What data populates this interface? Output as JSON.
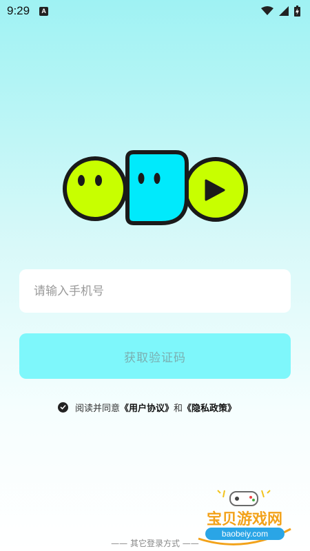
{
  "status_bar": {
    "time": "9:29",
    "notification_letter": "A",
    "icons": [
      "wifi-icon",
      "cell-signal-icon",
      "battery-charging-icon"
    ]
  },
  "logo": {
    "icons": [
      "green-face-icon",
      "cyan-face-icon",
      "play-face-icon"
    ],
    "colors": {
      "lime": "#c8ff00",
      "cyan": "#00eafc",
      "outline": "#1a1a1a"
    }
  },
  "login": {
    "phone_placeholder": "请输入手机号",
    "phone_value": "",
    "code_button_label": "获取验证码"
  },
  "agreement": {
    "checked": true,
    "prefix": "阅读并同意",
    "user_agreement": "《用户协议》",
    "conjunction": "和",
    "privacy_policy": "《隐私政策》"
  },
  "other_login": "—— 其它登录方式 ——",
  "watermark": {
    "name": "宝贝游戏网",
    "url": "baobeiy.com"
  },
  "colors": {
    "background_top": "#9ff2f3",
    "button": "#7ef7fb",
    "button_text": "#7aaeb0"
  }
}
